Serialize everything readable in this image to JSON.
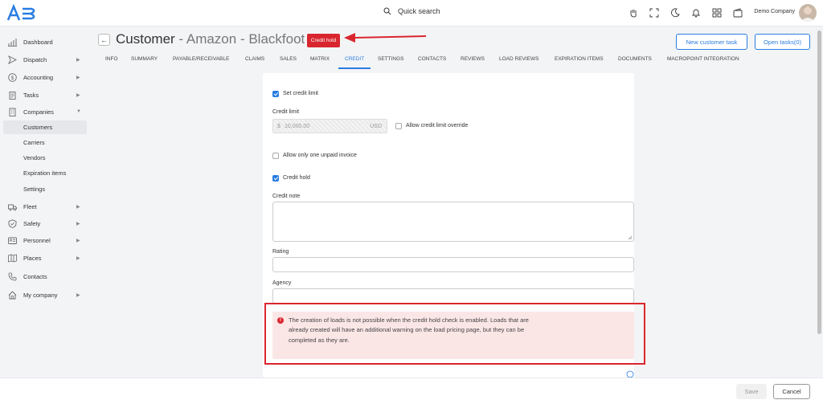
{
  "header": {
    "search_label": "Quick search",
    "company_name": "Demo Company"
  },
  "sidebar": {
    "items": [
      {
        "label": "Dashboard",
        "icon": "chart-icon"
      },
      {
        "label": "Dispatch",
        "icon": "send-icon"
      },
      {
        "label": "Accounting",
        "icon": "dollar-icon"
      },
      {
        "label": "Tasks",
        "icon": "clipboard-icon"
      },
      {
        "label": "Companies",
        "icon": "building-icon"
      },
      {
        "label": "Fleet",
        "icon": "truck-icon"
      },
      {
        "label": "Safety",
        "icon": "shield-icon"
      },
      {
        "label": "Personnel",
        "icon": "id-card-icon"
      },
      {
        "label": "Places",
        "icon": "map-icon"
      },
      {
        "label": "Contacts",
        "icon": "phone-icon"
      },
      {
        "label": "My company",
        "icon": "home-icon"
      }
    ],
    "companies_sub": [
      "Customers",
      "Carriers",
      "Vendors",
      "Expiration items",
      "Settings"
    ]
  },
  "page": {
    "title": "Customer",
    "subtitle": " - Amazon - Blackfoot",
    "badge": "Credit hold",
    "new_task_button": "New customer task",
    "open_tasks_button": "Open tasks(0)"
  },
  "tabs": [
    "INFO",
    "SUMMARY",
    "PAYABLE/RECEIVABLE",
    "CLAIMS",
    "SALES",
    "MATRIX",
    "CREDIT",
    "SETTINGS",
    "CONTACTS",
    "REVIEWS",
    "LOAD REVIEWS",
    "EXPIRATION ITEMS",
    "DOCUMENTS",
    "MACROPOINT INTEGRATION"
  ],
  "active_tab": "CREDIT",
  "form": {
    "set_credit_limit": "Set credit limit",
    "credit_limit_label": "Credit limit",
    "credit_limit_currency_symbol": "$",
    "credit_limit_value": "10,000.00",
    "credit_limit_unit": "USD",
    "allow_override": "Allow credit limit override",
    "one_unpaid": "Allow only one unpaid invoice",
    "credit_hold": "Credit hold",
    "credit_note_label": "Credit note",
    "rating_label": "Rating",
    "agency_label": "Agency"
  },
  "alert": {
    "text": "The creation of loads is not possible when the credit hold check is enabled. Loads that are already created will have an additional warning on the load pricing page, but they can be completed as they are."
  },
  "footer": {
    "save": "Save",
    "cancel": "Cancel"
  },
  "colors": {
    "accent": "#2a7de1",
    "danger": "#d9262e",
    "alert_bg": "#fbe6e6"
  }
}
